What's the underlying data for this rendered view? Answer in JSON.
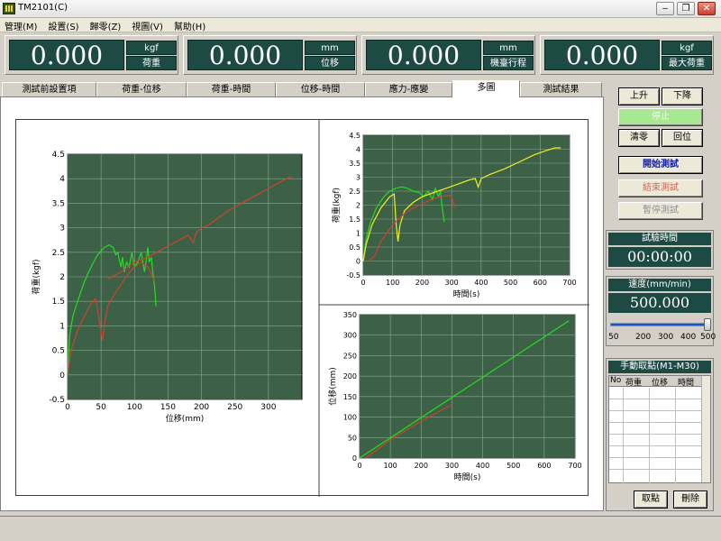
{
  "window": {
    "title": "TM2101(C)",
    "minimize": "‒",
    "restore": "❐",
    "close": "✕"
  },
  "menu": [
    "管理(M)",
    "設置(S)",
    "歸零(Z)",
    "視圖(V)",
    "幫助(H)"
  ],
  "meters": [
    {
      "value": "0.000",
      "unit": "kgf",
      "label": "荷重"
    },
    {
      "value": "0.000",
      "unit": "mm",
      "label": "位移"
    },
    {
      "value": "0.000",
      "unit": "mm",
      "label": "機臺行程"
    },
    {
      "value": "0.000",
      "unit": "kgf",
      "label": "最大荷重"
    }
  ],
  "tabs": [
    "測試前設置項",
    "荷重-位移",
    "荷重-時間",
    "位移-時間",
    "應力-應變",
    "多圖",
    "測試結果"
  ],
  "active_tab": "多圖",
  "side": {
    "up": "上升",
    "down": "下降",
    "stop": "停止",
    "zero": "清零",
    "return": "回位",
    "start": "開始測試",
    "end": "結束測試",
    "pause": "暫停測試",
    "timer_title": "試驗時間",
    "timer": "00:00:00",
    "speed_title": "速度(mm/min)",
    "speed": "500.000",
    "slider_ticks": [
      "50",
      "200",
      "300",
      "400",
      "500"
    ],
    "slider_value": 500,
    "manual_title": "手動取點(M1-M30)",
    "manual_cols": [
      "No",
      "荷重",
      "位移",
      "時間"
    ],
    "take_point": "取點",
    "delete": "刪除"
  },
  "colors": {
    "plot_bg": "#3d6147",
    "lcd_bg": "#1e4a44",
    "green": "#22dd22",
    "red": "#d04030",
    "yellow": "#f0f020"
  },
  "chart_data": [
    {
      "type": "line",
      "title": "",
      "xlabel": "位移(mm)",
      "ylabel": "荷重(kgf)",
      "xlim": [
        0,
        350
      ],
      "ylim": [
        -0.5,
        4.5
      ],
      "xticks": [
        "0",
        "50",
        "100",
        "150",
        "200",
        "250",
        "300"
      ],
      "yticks": [
        "-0.5",
        "0",
        "0.5",
        "1",
        "1.5",
        "2",
        "2.5",
        "3",
        "3.5",
        "4",
        "4.5"
      ],
      "grid": true,
      "series": [
        {
          "color": "green",
          "x": [
            0,
            3,
            8,
            15,
            25,
            35,
            45,
            55,
            62,
            68,
            72,
            75,
            78,
            80,
            82,
            85,
            88,
            92,
            96,
            100,
            105,
            110,
            115,
            120,
            122,
            125,
            128,
            130,
            132
          ],
          "y": [
            0,
            0.8,
            1.2,
            1.5,
            1.9,
            2.2,
            2.45,
            2.6,
            2.65,
            2.6,
            2.45,
            2.5,
            2.3,
            2.2,
            2.4,
            2.1,
            2.3,
            2.2,
            2.5,
            2.2,
            2.3,
            2.5,
            2.1,
            2.6,
            2.3,
            2.4,
            2.0,
            1.8,
            1.4
          ]
        },
        {
          "color": "red",
          "x": [
            0,
            5,
            15,
            25,
            35,
            42,
            48,
            52,
            56,
            60,
            70,
            80,
            90,
            100,
            110,
            120,
            130
          ],
          "y": [
            0,
            0.5,
            0.9,
            1.2,
            1.45,
            1.55,
            1.05,
            0.7,
            1.1,
            1.4,
            1.65,
            1.85,
            2.05,
            2.2,
            2.3,
            2.2,
            1.9
          ]
        },
        {
          "color": "red",
          "x": [
            60,
            80,
            100,
            120,
            140,
            160,
            180,
            185,
            188,
            192,
            200,
            210,
            220,
            240,
            260,
            280,
            300,
            320,
            330,
            335
          ],
          "y": [
            1.95,
            2.1,
            2.3,
            2.4,
            2.55,
            2.7,
            2.85,
            2.75,
            2.7,
            2.9,
            3.0,
            3.05,
            3.15,
            3.35,
            3.5,
            3.65,
            3.8,
            3.95,
            4.02,
            4.05
          ]
        }
      ]
    },
    {
      "type": "line",
      "title": "",
      "xlabel": "時間(s)",
      "ylabel": "荷重(kgf)",
      "xlim": [
        0,
        700
      ],
      "ylim": [
        -0.5,
        4.5
      ],
      "xticks": [
        "0",
        "100",
        "200",
        "300",
        "400",
        "500",
        "600",
        "700"
      ],
      "yticks": [
        "-0.5",
        "0",
        "0.5",
        "1",
        "1.5",
        "2",
        "2.5",
        "3",
        "3.5",
        "4",
        "4.5"
      ],
      "grid": true,
      "series": [
        {
          "color": "green",
          "x": [
            0,
            10,
            25,
            45,
            70,
            90,
            110,
            130,
            150,
            170,
            190,
            205,
            220,
            235,
            245,
            255,
            262,
            268,
            275
          ],
          "y": [
            0,
            0.8,
            1.4,
            1.9,
            2.3,
            2.5,
            2.6,
            2.65,
            2.6,
            2.5,
            2.45,
            2.3,
            2.5,
            2.2,
            2.6,
            2.3,
            2.5,
            1.9,
            1.4
          ]
        },
        {
          "color": "yellow",
          "x": [
            0,
            10,
            30,
            60,
            90,
            105,
            112,
            118,
            125,
            140,
            170,
            200,
            240,
            280,
            320,
            360,
            380,
            390,
            400,
            430,
            480,
            530,
            580,
            620,
            650,
            670
          ],
          "y": [
            0,
            0.6,
            1.3,
            1.9,
            2.3,
            2.4,
            1.3,
            0.7,
            1.3,
            1.8,
            2.1,
            2.3,
            2.45,
            2.6,
            2.75,
            2.9,
            2.95,
            2.65,
            2.95,
            3.1,
            3.3,
            3.55,
            3.8,
            3.95,
            4.05,
            4.05
          ]
        },
        {
          "color": "red",
          "x": [
            20,
            40,
            60,
            80,
            100,
            120,
            140,
            170,
            200,
            230,
            260,
            290,
            300,
            310
          ],
          "y": [
            0,
            0.2,
            0.7,
            1.0,
            1.3,
            1.5,
            1.7,
            1.9,
            2.05,
            2.2,
            2.3,
            2.35,
            2.3,
            1.9
          ]
        }
      ]
    },
    {
      "type": "line",
      "title": "",
      "xlabel": "時間(s)",
      "ylabel": "位移(mm)",
      "xlim": [
        0,
        700
      ],
      "ylim": [
        0,
        350
      ],
      "xticks": [
        "0",
        "100",
        "200",
        "300",
        "400",
        "500",
        "600",
        "700"
      ],
      "yticks": [
        "0",
        "50",
        "100",
        "150",
        "200",
        "250",
        "300",
        "350"
      ],
      "grid": true,
      "series": [
        {
          "color": "green",
          "x": [
            0,
            680
          ],
          "y": [
            0,
            335
          ]
        },
        {
          "color": "red",
          "x": [
            20,
            100,
            200,
            300
          ],
          "y": [
            0,
            45,
            90,
            130
          ]
        }
      ]
    }
  ]
}
